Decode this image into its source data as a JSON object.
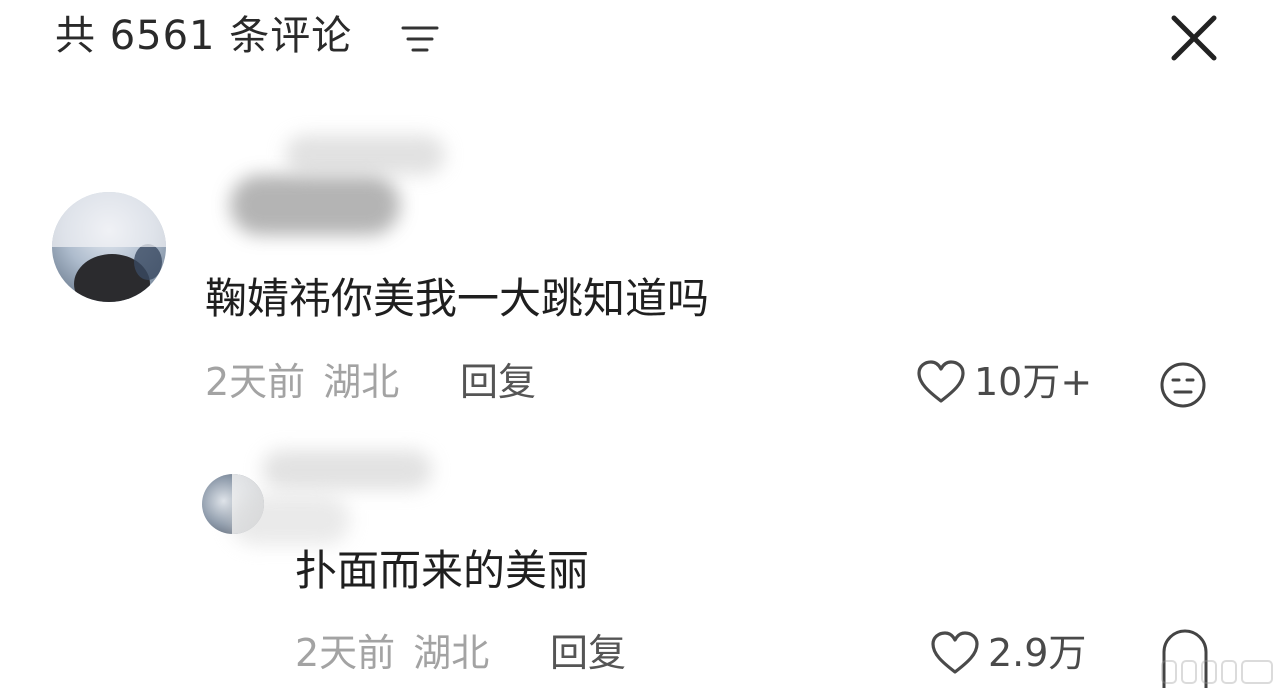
{
  "header": {
    "count_label": "共 6561 条评论",
    "sort_icon": "sort-lines-icon",
    "close_icon": "close-icon"
  },
  "comments": [
    {
      "text": "鞠婧祎你美我一大跳知道吗",
      "time": "2天前",
      "location": "湖北",
      "reply_label": "回复",
      "likes": "10万+",
      "like_icon": "heart-outline-icon",
      "reaction_icon": "neutral-face-icon"
    },
    {
      "text": "扑面而来的美丽",
      "time": "2天前",
      "location": "湖北",
      "reply_label": "回复",
      "likes": "2.9万",
      "like_icon": "heart-outline-icon",
      "reaction_icon": "neutral-face-icon"
    }
  ],
  "colors": {
    "text_primary": "#1f1f1f",
    "text_meta": "#a3a3a3",
    "text_reply": "#555555",
    "background": "#ffffff"
  }
}
